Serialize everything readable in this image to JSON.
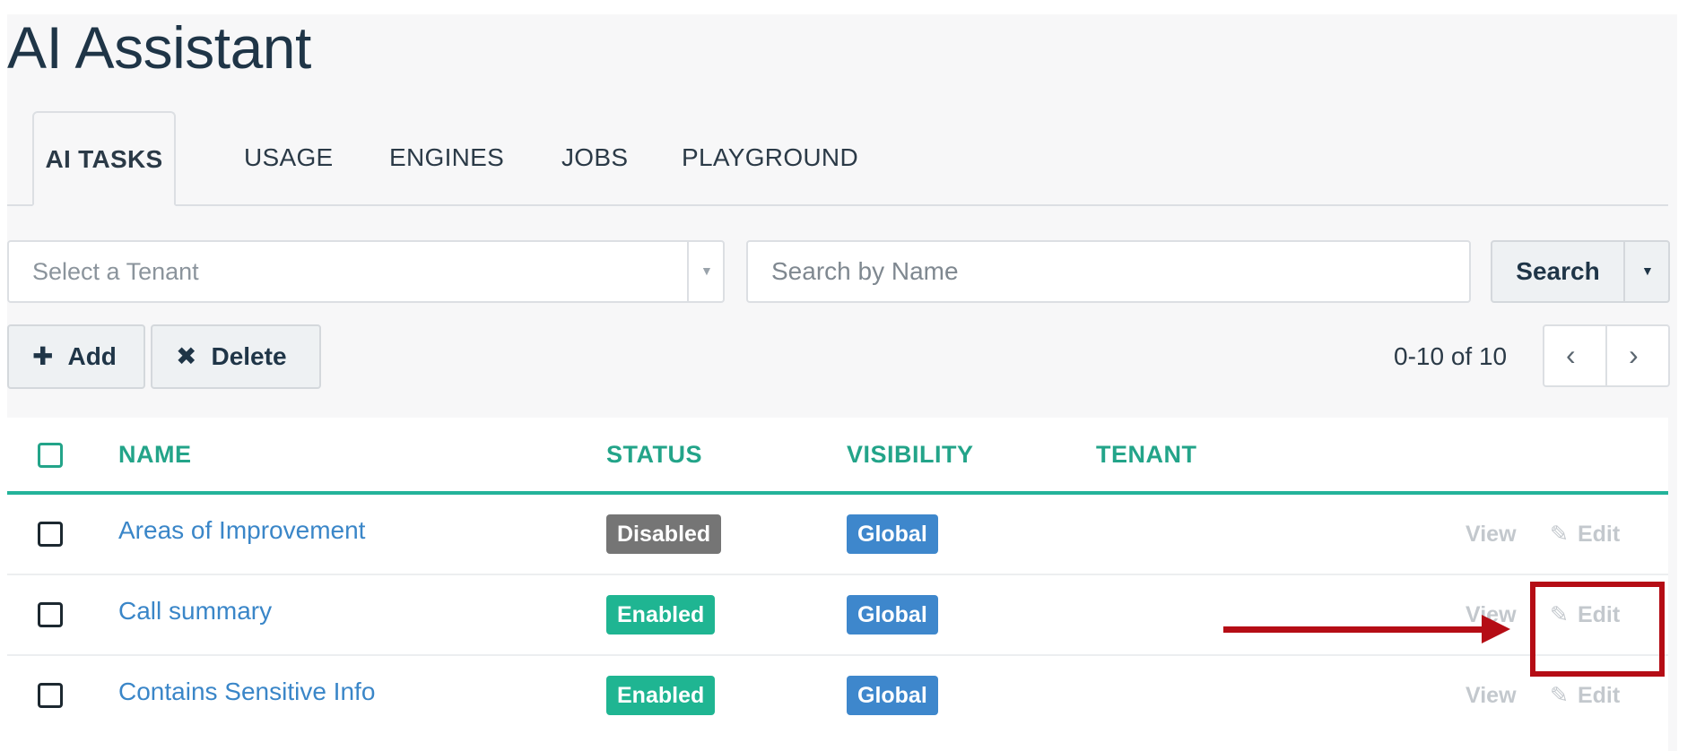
{
  "app": {
    "title": "AI Assistant"
  },
  "tabs": [
    {
      "label": "AI TASKS",
      "active": true
    },
    {
      "label": "USAGE",
      "active": false
    },
    {
      "label": "ENGINES",
      "active": false
    },
    {
      "label": "JOBS",
      "active": false
    },
    {
      "label": "PLAYGROUND",
      "active": false
    }
  ],
  "filters": {
    "tenant_placeholder": "Select a Tenant",
    "search_placeholder": "Search by Name",
    "search_label": "Search"
  },
  "toolbar": {
    "add_label": "Add",
    "delete_label": "Delete",
    "range_text": "0-10 of 10"
  },
  "icons": {
    "add": "plus-icon",
    "delete": "x-icon",
    "caret": "caret-down-icon",
    "prev": "chevron-left-icon",
    "next": "chevron-right-icon",
    "edit": "pencil-square-icon"
  },
  "table": {
    "headers": {
      "name": "NAME",
      "status": "STATUS",
      "visibility": "VISIBILITY",
      "tenant": "TENANT"
    },
    "rows": [
      {
        "name": "Areas of Improvement",
        "status": "Disabled",
        "visibility": "Global",
        "tenant": "",
        "view": "View",
        "edit": "Edit"
      },
      {
        "name": "Call summary",
        "status": "Enabled",
        "visibility": "Global",
        "tenant": "",
        "view": "View",
        "edit": "Edit"
      },
      {
        "name": "Contains Sensitive Info",
        "status": "Enabled",
        "visibility": "Global",
        "tenant": "",
        "view": "View",
        "edit": "Edit"
      }
    ]
  },
  "colors": {
    "accent": "#23a489",
    "link": "#3a86c8",
    "enabled": "#1fb592",
    "disabled": "#757575",
    "global": "#3e87cc",
    "annotation": "#b50d15"
  }
}
